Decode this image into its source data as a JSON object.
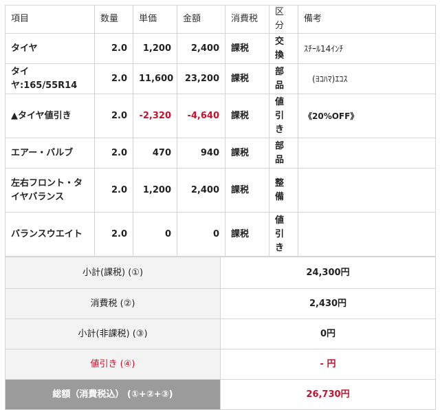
{
  "headers": [
    "項目",
    "数量",
    "単価",
    "金額",
    "消費税",
    "区分",
    "備考"
  ],
  "items": [
    {
      "name": "タイヤ",
      "qty": "2.0",
      "unit": "1,200",
      "amount": "2,400",
      "tax": "課税",
      "type": "交換",
      "note": "ｽﾁｰﾙ14ｲﾝﾁ"
    },
    {
      "name": "タイヤ:165/55R14",
      "qty": "2.0",
      "unit": "11,600",
      "amount": "23,200",
      "tax": "課税",
      "type": "部品",
      "note": "　(ﾖｺﾊﾏ)ｴｺｽ"
    },
    {
      "name": "▲タイヤ値引き",
      "qty": "2.0",
      "unit": "-2,320",
      "amount": "-4,640",
      "tax": "課税",
      "type": "値引き",
      "note": "《20%OFF》"
    },
    {
      "name": "エアー・バルブ",
      "qty": "2.0",
      "unit": "470",
      "amount": "940",
      "tax": "課税",
      "type": "部品",
      "note": ""
    },
    {
      "name": "左右フロント・タイヤバランス",
      "qty": "2.0",
      "unit": "1,200",
      "amount": "2,400",
      "tax": "課税",
      "type": "整備",
      "note": ""
    },
    {
      "name": "バランスウエイト",
      "qty": "2.0",
      "unit": "0",
      "amount": "0",
      "tax": "課税",
      "type": "値引き",
      "note": ""
    }
  ],
  "totals": {
    "subtotal_taxable": {
      "label": "小計(課税) (①)",
      "value": "24,300円"
    },
    "consumption_tax": {
      "label": "消費税 (②)",
      "value": "2,430円"
    },
    "subtotal_nontaxable": {
      "label": "小計(非課税) (③)",
      "value": "0円"
    },
    "discount": {
      "label": "値引き (④)",
      "value": "- 円"
    },
    "grand_total": {
      "label": "総額（消費税込） (①+②+③)",
      "value": "26,730円"
    }
  },
  "colors": {
    "accent_red": "#c8102e",
    "grand_label_bg": "#9b9b9b",
    "label_bg": "#f3f3f3"
  }
}
